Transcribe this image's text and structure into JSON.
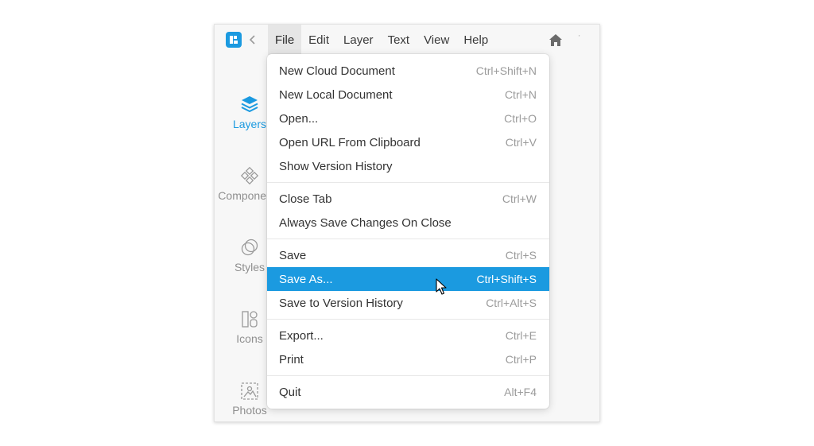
{
  "colors": {
    "accent": "#1b9ae0",
    "text": "#333333",
    "muted": "#9b9b9b"
  },
  "menubar": {
    "items": [
      "File",
      "Edit",
      "Layer",
      "Text",
      "View",
      "Help"
    ],
    "active": "File"
  },
  "tiny_mark": "'",
  "sidebar": {
    "items": [
      {
        "label": "Layers",
        "icon": "layers-icon",
        "active": true
      },
      {
        "label": "Components",
        "icon": "components-icon"
      },
      {
        "label": "Styles",
        "icon": "styles-icon"
      },
      {
        "label": "Icons",
        "icon": "icons-icon"
      },
      {
        "label": "Photos",
        "icon": "photos-icon"
      }
    ]
  },
  "file_menu": {
    "groups": [
      [
        {
          "label": "New Cloud Document",
          "shortcut": "Ctrl+Shift+N"
        },
        {
          "label": "New Local Document",
          "shortcut": "Ctrl+N"
        },
        {
          "label": "Open...",
          "shortcut": "Ctrl+O"
        },
        {
          "label": "Open URL From Clipboard",
          "shortcut": "Ctrl+V"
        },
        {
          "label": "Show Version History",
          "shortcut": ""
        }
      ],
      [
        {
          "label": "Close Tab",
          "shortcut": "Ctrl+W"
        },
        {
          "label": "Always Save Changes On Close",
          "shortcut": ""
        }
      ],
      [
        {
          "label": "Save",
          "shortcut": "Ctrl+S"
        },
        {
          "label": "Save As...",
          "shortcut": "Ctrl+Shift+S",
          "highlighted": true
        },
        {
          "label": "Save to Version History",
          "shortcut": "Ctrl+Alt+S"
        }
      ],
      [
        {
          "label": "Export...",
          "shortcut": "Ctrl+E"
        },
        {
          "label": "Print",
          "shortcut": "Ctrl+P"
        }
      ],
      [
        {
          "label": "Quit",
          "shortcut": "Alt+F4"
        }
      ]
    ]
  }
}
